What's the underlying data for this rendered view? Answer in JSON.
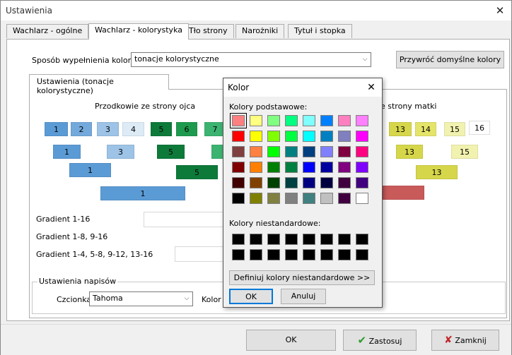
{
  "window": {
    "title": "Ustawienia",
    "close_glyph": "✕"
  },
  "tabs": [
    "Wachlarz - ogólne",
    "Wachlarz - kolorystyka",
    "Tło strony",
    "Narożniki",
    "Tytuł i stopka"
  ],
  "fill": {
    "label": "Sposób wypełnienia kolorem",
    "value": "tonacje kolorystyczne",
    "restore_button": "Przywróć domyślne kolory"
  },
  "subtab": "Ustawienia (tonacje kolorystyczne)",
  "father": {
    "header": "Przodkowie ze strony ojca",
    "row1": [
      {
        "t": "1",
        "c": "#5b9bd5"
      },
      {
        "t": "2",
        "c": "#74a9dc"
      },
      {
        "t": "3",
        "c": "#9dc3e6"
      },
      {
        "t": "4",
        "c": "#ddebf7"
      },
      {
        "t": "5",
        "c": "#0d7a3a"
      },
      {
        "t": "6",
        "c": "#1e9a4e"
      },
      {
        "t": "7",
        "c": "#3cb371"
      }
    ],
    "row2": [
      {
        "t": "1",
        "c": "#5b9bd5"
      },
      {
        "t": "3",
        "c": "#9dc3e6"
      },
      {
        "t": "5",
        "c": "#0d7a3a"
      },
      {
        "t": "",
        "c": "#3cb371"
      }
    ],
    "row3": [
      {
        "t": "1",
        "c": "#5b9bd5"
      },
      {
        "t": "5",
        "c": "#0d7a3a"
      }
    ],
    "row4": [
      {
        "t": "1",
        "c": "#5b9bd5"
      }
    ]
  },
  "mother": {
    "header": "e strony matki",
    "row1": [
      {
        "t": "13",
        "c": "#d6d64b"
      },
      {
        "t": "14",
        "c": "#e4e46a"
      },
      {
        "t": "15",
        "c": "#f2f2b0"
      },
      {
        "t": "16",
        "c": "#ffffff"
      }
    ],
    "row2": [
      {
        "t": "13",
        "c": "#d6d64b"
      },
      {
        "t": "15",
        "c": "#f2f2b0"
      }
    ],
    "row3": [
      {
        "t": "13",
        "c": "#d6d64b"
      }
    ],
    "row4": [
      {
        "t": "",
        "c": "#c95a5a"
      }
    ]
  },
  "gradients": [
    "Gradient 1-16",
    "Gradient 1-8, 9-16",
    "Gradient 1-4, 5-8, 9-12, 13-16"
  ],
  "caption": {
    "legend": "Ustawienia napisów",
    "font_label": "Czcionka",
    "font_value": "Tahoma",
    "color_label": "Kolor"
  },
  "dialog": {
    "title": "Kolor",
    "close_glyph": "✕",
    "basic_label": "Kolory podstawowe:",
    "basic_colors": [
      "#ff8080",
      "#ffff80",
      "#80ff80",
      "#00ff80",
      "#80ffff",
      "#0080ff",
      "#ff80c0",
      "#ff80ff",
      "#ff0000",
      "#ffff00",
      "#80ff00",
      "#00ff40",
      "#00ffff",
      "#0080c0",
      "#8080c0",
      "#ff00ff",
      "#804040",
      "#ff8040",
      "#00ff00",
      "#008080",
      "#004080",
      "#8080ff",
      "#800040",
      "#ff0080",
      "#800000",
      "#ff8000",
      "#008000",
      "#008040",
      "#0000ff",
      "#0000a0",
      "#800080",
      "#8000ff",
      "#400000",
      "#804000",
      "#004000",
      "#004040",
      "#000080",
      "#000040",
      "#400040",
      "#400080",
      "#000000",
      "#808000",
      "#808040",
      "#808080",
      "#408080",
      "#c0c0c0",
      "#400040",
      "#ffffff"
    ],
    "custom_label": "Kolory niestandardowe:",
    "custom_colors": [
      "#000000",
      "#000000",
      "#000000",
      "#000000",
      "#000000",
      "#000000",
      "#000000",
      "#000000",
      "#000000",
      "#000000",
      "#000000",
      "#000000",
      "#000000",
      "#000000",
      "#000000",
      "#000000"
    ],
    "define_button": "Definiuj kolory niestandardowe >>",
    "ok": "OK",
    "cancel": "Anuluj"
  },
  "bottom": {
    "ok": "OK",
    "apply": "Zastosuj",
    "close": "Zamknij",
    "apply_icon": "✔",
    "close_icon": "✘"
  }
}
